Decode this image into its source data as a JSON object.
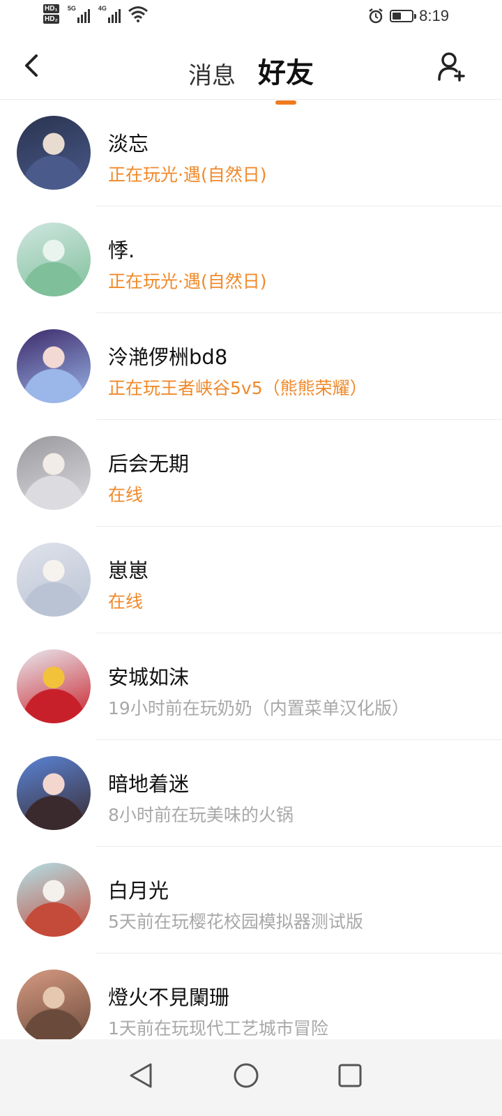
{
  "status_bar": {
    "hd1": "HD₁",
    "hd2": "HD₂",
    "net1": "5G",
    "net2": "4G",
    "battery_level": 0.45,
    "time": "8:19"
  },
  "header": {
    "tabs": [
      {
        "label": "消息",
        "active": false
      },
      {
        "label": "好友",
        "active": true
      }
    ]
  },
  "friends": [
    {
      "name": "淡忘",
      "status": "正在玩光·遇(自然日)",
      "online": true,
      "colors": [
        "#2a3350",
        "#4a5a8a",
        "#e8dcd0"
      ]
    },
    {
      "name": "悸.",
      "status": "正在玩光·遇(自然日)",
      "online": true,
      "colors": [
        "#cfe6e0",
        "#7fbf9a",
        "#e9f4ef"
      ]
    },
    {
      "name": "泠滟㑩栦bd8",
      "status": "正在玩王者峡谷5v5（熊熊荣耀）",
      "online": true,
      "colors": [
        "#3d2a6b",
        "#9bb6e8",
        "#f2d9d3"
      ]
    },
    {
      "name": "后会无期",
      "status": "在线",
      "online": true,
      "colors": [
        "#9a9a9e",
        "#dcdce0",
        "#f1ece6"
      ]
    },
    {
      "name": "崽崽",
      "status": "在线",
      "online": true,
      "colors": [
        "#dfe2ea",
        "#b9c3d4",
        "#f6f3ee"
      ]
    },
    {
      "name": "安城如沫",
      "status": "19小时前在玩奶奶（内置菜单汉化版）",
      "online": false,
      "colors": [
        "#e8e8ee",
        "#c8202a",
        "#f2c23a"
      ]
    },
    {
      "name": "暗地着迷",
      "status": "8小时前在玩美味的火锅",
      "online": false,
      "colors": [
        "#5a84d6",
        "#3a2a2e",
        "#f3d7cf"
      ]
    },
    {
      "name": "白月光",
      "status": "5天前在玩樱花校园模拟器测试版",
      "online": false,
      "colors": [
        "#b3e0e6",
        "#c44a3a",
        "#f4f0ec"
      ]
    },
    {
      "name": "燈火不見闌珊",
      "status": "1天前在玩现代工艺城市冒险",
      "online": false,
      "colors": [
        "#d69a82",
        "#6a4a3a",
        "#e6c8b0"
      ]
    }
  ],
  "nav": {
    "buttons": [
      "back",
      "home",
      "recents"
    ]
  }
}
